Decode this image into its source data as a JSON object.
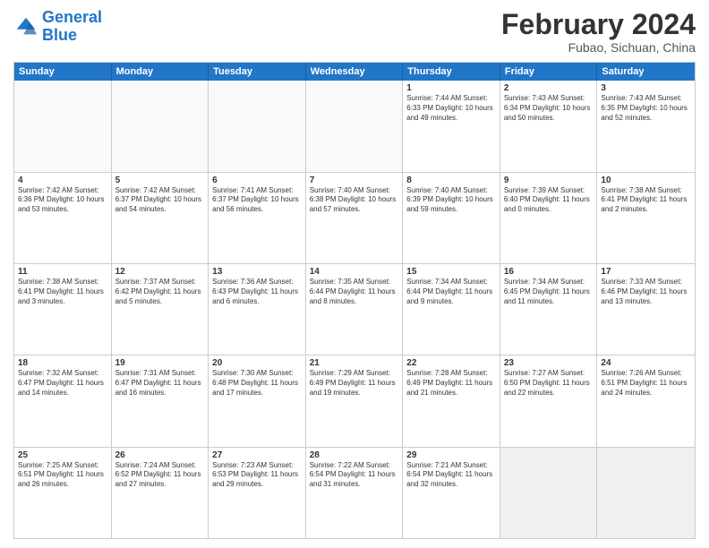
{
  "logo": {
    "general": "General",
    "blue": "Blue"
  },
  "title": "February 2024",
  "subtitle": "Fubao, Sichuan, China",
  "header_days": [
    "Sunday",
    "Monday",
    "Tuesday",
    "Wednesday",
    "Thursday",
    "Friday",
    "Saturday"
  ],
  "weeks": [
    [
      {
        "day": "",
        "info": "",
        "empty": true
      },
      {
        "day": "",
        "info": "",
        "empty": true
      },
      {
        "day": "",
        "info": "",
        "empty": true
      },
      {
        "day": "",
        "info": "",
        "empty": true
      },
      {
        "day": "1",
        "info": "Sunrise: 7:44 AM\nSunset: 6:33 PM\nDaylight: 10 hours\nand 49 minutes."
      },
      {
        "day": "2",
        "info": "Sunrise: 7:43 AM\nSunset: 6:34 PM\nDaylight: 10 hours\nand 50 minutes."
      },
      {
        "day": "3",
        "info": "Sunrise: 7:43 AM\nSunset: 6:35 PM\nDaylight: 10 hours\nand 52 minutes."
      }
    ],
    [
      {
        "day": "4",
        "info": "Sunrise: 7:42 AM\nSunset: 6:36 PM\nDaylight: 10 hours\nand 53 minutes."
      },
      {
        "day": "5",
        "info": "Sunrise: 7:42 AM\nSunset: 6:37 PM\nDaylight: 10 hours\nand 54 minutes."
      },
      {
        "day": "6",
        "info": "Sunrise: 7:41 AM\nSunset: 6:37 PM\nDaylight: 10 hours\nand 56 minutes."
      },
      {
        "day": "7",
        "info": "Sunrise: 7:40 AM\nSunset: 6:38 PM\nDaylight: 10 hours\nand 57 minutes."
      },
      {
        "day": "8",
        "info": "Sunrise: 7:40 AM\nSunset: 6:39 PM\nDaylight: 10 hours\nand 59 minutes."
      },
      {
        "day": "9",
        "info": "Sunrise: 7:39 AM\nSunset: 6:40 PM\nDaylight: 11 hours\nand 0 minutes."
      },
      {
        "day": "10",
        "info": "Sunrise: 7:38 AM\nSunset: 6:41 PM\nDaylight: 11 hours\nand 2 minutes."
      }
    ],
    [
      {
        "day": "11",
        "info": "Sunrise: 7:38 AM\nSunset: 6:41 PM\nDaylight: 11 hours\nand 3 minutes."
      },
      {
        "day": "12",
        "info": "Sunrise: 7:37 AM\nSunset: 6:42 PM\nDaylight: 11 hours\nand 5 minutes."
      },
      {
        "day": "13",
        "info": "Sunrise: 7:36 AM\nSunset: 6:43 PM\nDaylight: 11 hours\nand 6 minutes."
      },
      {
        "day": "14",
        "info": "Sunrise: 7:35 AM\nSunset: 6:44 PM\nDaylight: 11 hours\nand 8 minutes."
      },
      {
        "day": "15",
        "info": "Sunrise: 7:34 AM\nSunset: 6:44 PM\nDaylight: 11 hours\nand 9 minutes."
      },
      {
        "day": "16",
        "info": "Sunrise: 7:34 AM\nSunset: 6:45 PM\nDaylight: 11 hours\nand 11 minutes."
      },
      {
        "day": "17",
        "info": "Sunrise: 7:33 AM\nSunset: 6:46 PM\nDaylight: 11 hours\nand 13 minutes."
      }
    ],
    [
      {
        "day": "18",
        "info": "Sunrise: 7:32 AM\nSunset: 6:47 PM\nDaylight: 11 hours\nand 14 minutes."
      },
      {
        "day": "19",
        "info": "Sunrise: 7:31 AM\nSunset: 6:47 PM\nDaylight: 11 hours\nand 16 minutes."
      },
      {
        "day": "20",
        "info": "Sunrise: 7:30 AM\nSunset: 6:48 PM\nDaylight: 11 hours\nand 17 minutes."
      },
      {
        "day": "21",
        "info": "Sunrise: 7:29 AM\nSunset: 6:49 PM\nDaylight: 11 hours\nand 19 minutes."
      },
      {
        "day": "22",
        "info": "Sunrise: 7:28 AM\nSunset: 6:49 PM\nDaylight: 11 hours\nand 21 minutes."
      },
      {
        "day": "23",
        "info": "Sunrise: 7:27 AM\nSunset: 6:50 PM\nDaylight: 11 hours\nand 22 minutes."
      },
      {
        "day": "24",
        "info": "Sunrise: 7:26 AM\nSunset: 6:51 PM\nDaylight: 11 hours\nand 24 minutes."
      }
    ],
    [
      {
        "day": "25",
        "info": "Sunrise: 7:25 AM\nSunset: 6:51 PM\nDaylight: 11 hours\nand 26 minutes."
      },
      {
        "day": "26",
        "info": "Sunrise: 7:24 AM\nSunset: 6:52 PM\nDaylight: 11 hours\nand 27 minutes."
      },
      {
        "day": "27",
        "info": "Sunrise: 7:23 AM\nSunset: 6:53 PM\nDaylight: 11 hours\nand 29 minutes."
      },
      {
        "day": "28",
        "info": "Sunrise: 7:22 AM\nSunset: 6:54 PM\nDaylight: 11 hours\nand 31 minutes."
      },
      {
        "day": "29",
        "info": "Sunrise: 7:21 AM\nSunset: 6:54 PM\nDaylight: 11 hours\nand 32 minutes."
      },
      {
        "day": "",
        "info": "",
        "empty": true,
        "shaded": true
      },
      {
        "day": "",
        "info": "",
        "empty": true,
        "shaded": true
      }
    ]
  ]
}
